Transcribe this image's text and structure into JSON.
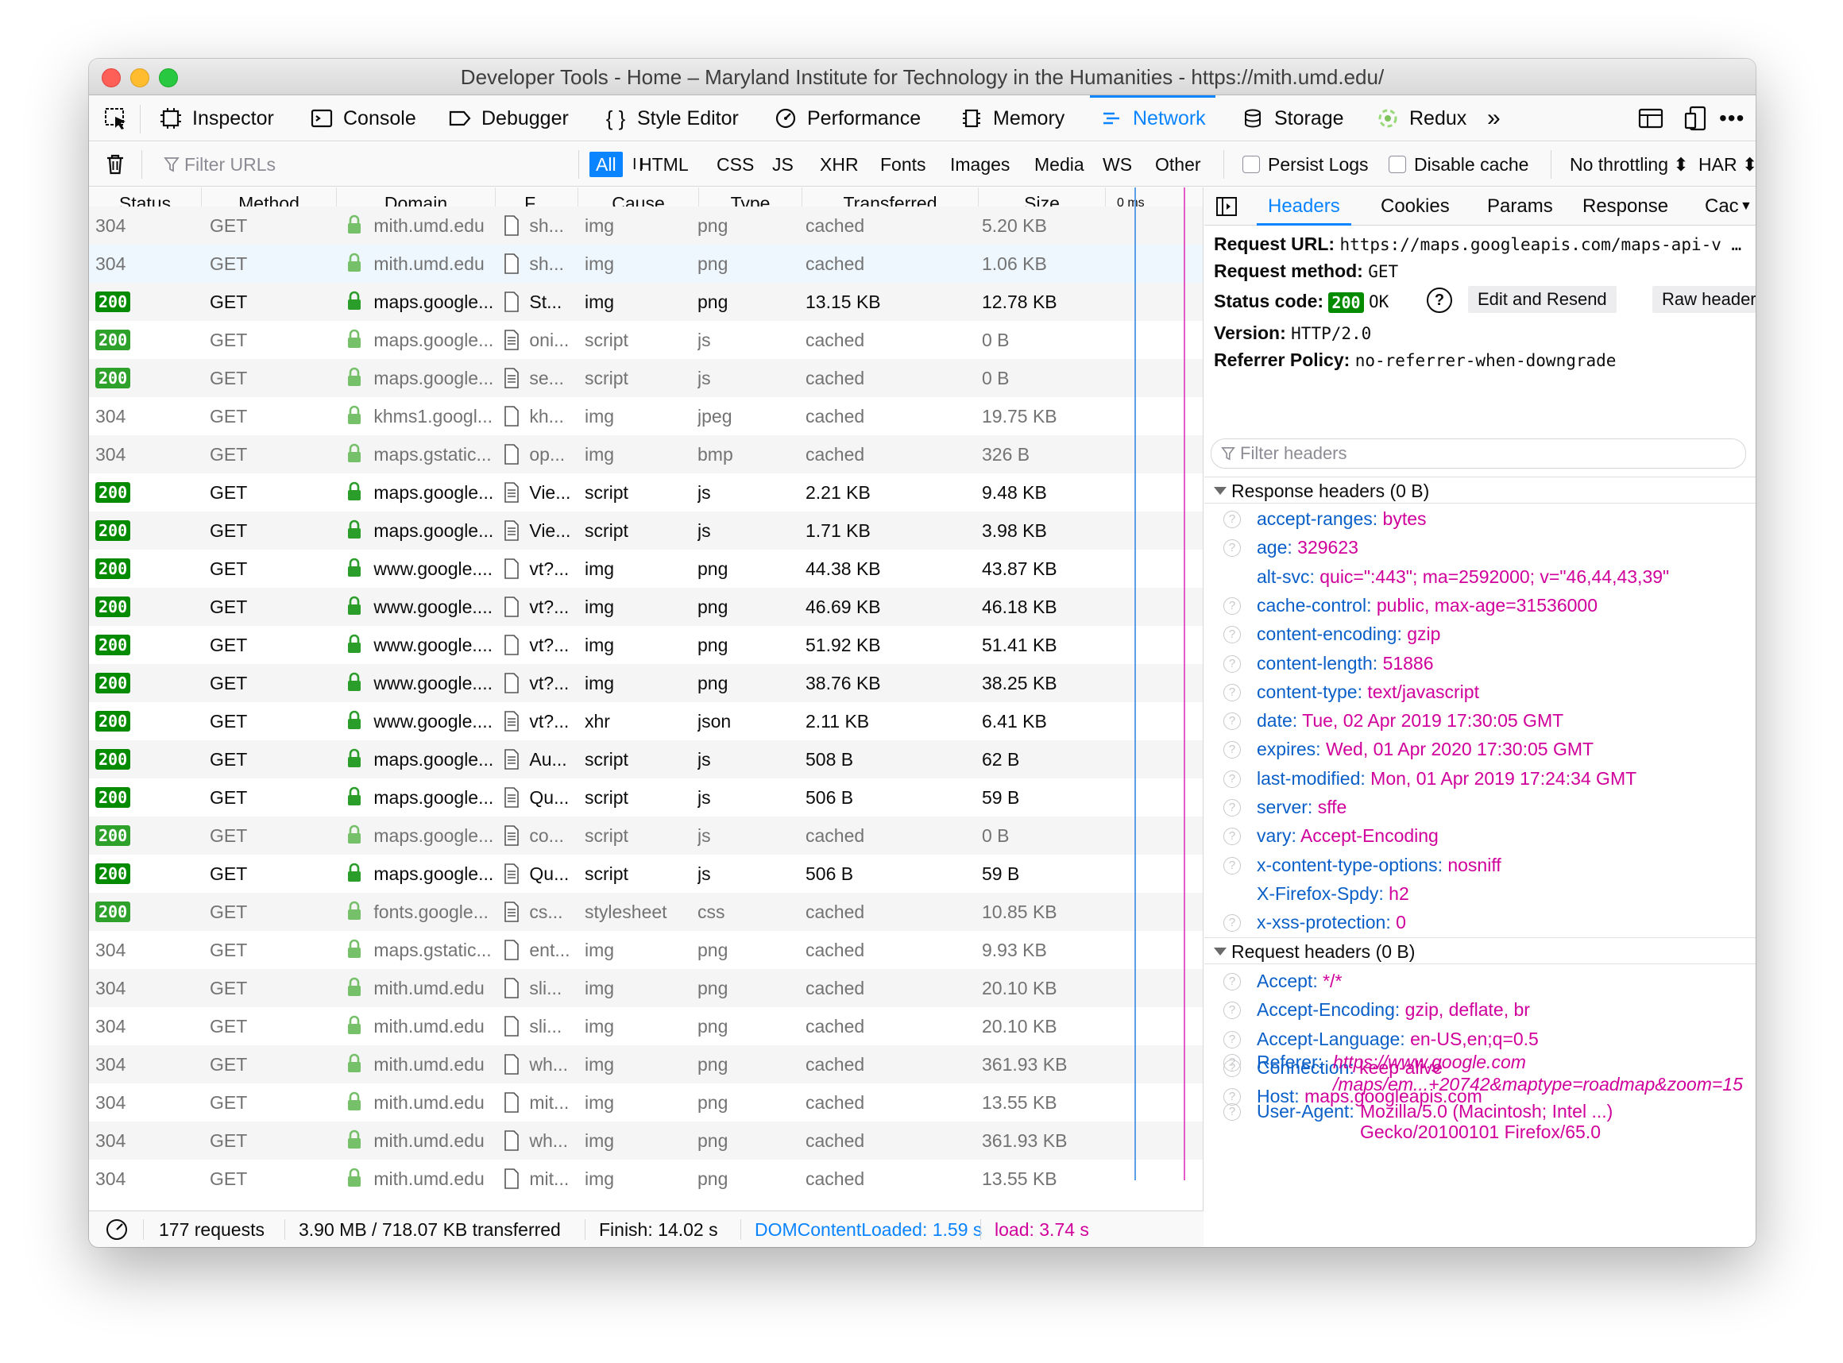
{
  "window": {
    "title": "Developer Tools - Home – Maryland Institute for Technology in the Humanities - https://mith.umd.edu/"
  },
  "toolbar": {
    "picker_icon": "element-picker-icon",
    "tools": [
      {
        "label": "Inspector",
        "icon": "inspector-icon"
      },
      {
        "label": "Console",
        "icon": "console-icon"
      },
      {
        "label": "Debugger",
        "icon": "debugger-icon"
      },
      {
        "label": "Style Editor",
        "icon": "braces-icon"
      },
      {
        "label": "Performance",
        "icon": "gauge-icon"
      },
      {
        "label": "Memory",
        "icon": "chip-icon"
      },
      {
        "label": "Network",
        "icon": "network-icon",
        "selected": true
      },
      {
        "label": "Storage",
        "icon": "database-icon"
      },
      {
        "label": "Redux",
        "icon": "redux-icon"
      }
    ],
    "overflow": "»",
    "accent": "#0a84ff"
  },
  "filterbar": {
    "placeholder": "Filter URLs",
    "pause": "I I",
    "types": [
      "All",
      "HTML",
      "CSS",
      "JS",
      "XHR",
      "Fonts",
      "Images",
      "Media",
      "WS",
      "Other"
    ],
    "active_type": "All",
    "persist_logs": "Persist Logs",
    "disable_cache": "Disable cache",
    "throttling": "No throttling ⬍",
    "har": "HAR ⬍"
  },
  "columns": [
    "Status",
    "Method",
    "Domain",
    "F...",
    "Cause",
    "Type",
    "Transferred",
    "Size"
  ],
  "waterfall_label": "0 ms",
  "requests": [
    {
      "status": "304",
      "method": "GET",
      "domain": "mith.umd.edu",
      "file": "sh...",
      "cause": "img",
      "type": "png",
      "transferred": "cached",
      "size": "5.20 KB",
      "cached": true
    },
    {
      "status": "304",
      "method": "GET",
      "domain": "mith.umd.edu",
      "file": "sh...",
      "cause": "img",
      "type": "png",
      "transferred": "cached",
      "size": "1.06 KB",
      "cached": true
    },
    {
      "status": "200",
      "method": "GET",
      "domain": "maps.google...",
      "file": "St...",
      "cause": "img",
      "type": "png",
      "transferred": "13.15 KB",
      "size": "12.78 KB",
      "cached": false
    },
    {
      "status": "200",
      "method": "GET",
      "domain": "maps.google...",
      "file": "oni...",
      "cause": "script",
      "type": "js",
      "transferred": "cached",
      "size": "0 B",
      "cached": true
    },
    {
      "status": "200",
      "method": "GET",
      "domain": "maps.google...",
      "file": "se...",
      "cause": "script",
      "type": "js",
      "transferred": "cached",
      "size": "0 B",
      "cached": true
    },
    {
      "status": "304",
      "method": "GET",
      "domain": "khms1.googl...",
      "file": "kh...",
      "cause": "img",
      "type": "jpeg",
      "transferred": "cached",
      "size": "19.75 KB",
      "cached": true
    },
    {
      "status": "304",
      "method": "GET",
      "domain": "maps.gstatic...",
      "file": "op...",
      "cause": "img",
      "type": "bmp",
      "transferred": "cached",
      "size": "326 B",
      "cached": true
    },
    {
      "status": "200",
      "method": "GET",
      "domain": "maps.google...",
      "file": "Vie...",
      "cause": "script",
      "type": "js",
      "transferred": "2.21 KB",
      "size": "9.48 KB",
      "cached": false
    },
    {
      "status": "200",
      "method": "GET",
      "domain": "maps.google...",
      "file": "Vie...",
      "cause": "script",
      "type": "js",
      "transferred": "1.71 KB",
      "size": "3.98 KB",
      "cached": false
    },
    {
      "status": "200",
      "method": "GET",
      "domain": "www.google....",
      "file": "vt?...",
      "cause": "img",
      "type": "png",
      "transferred": "44.38 KB",
      "size": "43.87 KB",
      "cached": false
    },
    {
      "status": "200",
      "method": "GET",
      "domain": "www.google....",
      "file": "vt?...",
      "cause": "img",
      "type": "png",
      "transferred": "46.69 KB",
      "size": "46.18 KB",
      "cached": false
    },
    {
      "status": "200",
      "method": "GET",
      "domain": "www.google....",
      "file": "vt?...",
      "cause": "img",
      "type": "png",
      "transferred": "51.92 KB",
      "size": "51.41 KB",
      "cached": false
    },
    {
      "status": "200",
      "method": "GET",
      "domain": "www.google....",
      "file": "vt?...",
      "cause": "img",
      "type": "png",
      "transferred": "38.76 KB",
      "size": "38.25 KB",
      "cached": false
    },
    {
      "status": "200",
      "method": "GET",
      "domain": "www.google....",
      "file": "vt?...",
      "cause": "xhr",
      "type": "json",
      "transferred": "2.11 KB",
      "size": "6.41 KB",
      "cached": false
    },
    {
      "status": "200",
      "method": "GET",
      "domain": "maps.google...",
      "file": "Au...",
      "cause": "script",
      "type": "js",
      "transferred": "508 B",
      "size": "62 B",
      "cached": false
    },
    {
      "status": "200",
      "method": "GET",
      "domain": "maps.google...",
      "file": "Qu...",
      "cause": "script",
      "type": "js",
      "transferred": "506 B",
      "size": "59 B",
      "cached": false
    },
    {
      "status": "200",
      "method": "GET",
      "domain": "maps.google...",
      "file": "co...",
      "cause": "script",
      "type": "js",
      "transferred": "cached",
      "size": "0 B",
      "cached": true
    },
    {
      "status": "200",
      "method": "GET",
      "domain": "maps.google...",
      "file": "Qu...",
      "cause": "script",
      "type": "js",
      "transferred": "506 B",
      "size": "59 B",
      "cached": false
    },
    {
      "status": "200",
      "method": "GET",
      "domain": "fonts.google...",
      "file": "cs...",
      "cause": "stylesheet",
      "type": "css",
      "transferred": "cached",
      "size": "10.85 KB",
      "cached": true
    },
    {
      "status": "304",
      "method": "GET",
      "domain": "maps.gstatic...",
      "file": "ent...",
      "cause": "img",
      "type": "png",
      "transferred": "cached",
      "size": "9.93 KB",
      "cached": true
    },
    {
      "status": "304",
      "method": "GET",
      "domain": "mith.umd.edu",
      "file": "sli...",
      "cause": "img",
      "type": "png",
      "transferred": "cached",
      "size": "20.10 KB",
      "cached": true
    },
    {
      "status": "304",
      "method": "GET",
      "domain": "mith.umd.edu",
      "file": "sli...",
      "cause": "img",
      "type": "png",
      "transferred": "cached",
      "size": "20.10 KB",
      "cached": true
    },
    {
      "status": "304",
      "method": "GET",
      "domain": "mith.umd.edu",
      "file": "wh...",
      "cause": "img",
      "type": "png",
      "transferred": "cached",
      "size": "361.93 KB",
      "cached": true
    },
    {
      "status": "304",
      "method": "GET",
      "domain": "mith.umd.edu",
      "file": "mit...",
      "cause": "img",
      "type": "png",
      "transferred": "cached",
      "size": "13.55 KB",
      "cached": true
    },
    {
      "status": "304",
      "method": "GET",
      "domain": "mith.umd.edu",
      "file": "wh...",
      "cause": "img",
      "type": "png",
      "transferred": "cached",
      "size": "361.93 KB",
      "cached": true
    },
    {
      "status": "304",
      "method": "GET",
      "domain": "mith.umd.edu",
      "file": "mit...",
      "cause": "img",
      "type": "png",
      "transferred": "cached",
      "size": "13.55 KB",
      "cached": true
    }
  ],
  "statusbar": {
    "requests": "177 requests",
    "transferred": "3.90 MB / 718.07 KB transferred",
    "finish": "Finish: 14.02 s",
    "dom": "DOMContentLoaded: 1.59 s",
    "load": "load: 3.74 s",
    "dom_color": "#0a84ff",
    "load_color": "#d0009b"
  },
  "side": {
    "tabs": [
      "Headers",
      "Cookies",
      "Params",
      "Response",
      "Cac"
    ],
    "selected_tab": "Headers",
    "summary": {
      "url_label": "Request URL:",
      "url": "https://maps.googleapis.com/maps-api-v …",
      "method_label": "Request method:",
      "method": "GET",
      "status_label": "Status code:",
      "status_code": "200",
      "status_text": "OK",
      "edit_resend": "Edit and Resend",
      "raw_headers": "Raw headers",
      "version_label": "Version:",
      "version": "HTTP/2.0",
      "referrer_label": "Referrer Policy:",
      "referrer": "no-referrer-when-downgrade"
    },
    "filter_placeholder": "Filter headers",
    "response_title": "Response headers (0 B)",
    "response_headers": [
      {
        "name": "accept-ranges:",
        "value": "bytes",
        "help": true
      },
      {
        "name": "age:",
        "value": "329623",
        "help": true
      },
      {
        "name": "alt-svc:",
        "value": "quic=\":443\"; ma=2592000; v=\"46,44,43,39\"",
        "help": false
      },
      {
        "name": "cache-control:",
        "value": "public, max-age=31536000",
        "help": true
      },
      {
        "name": "content-encoding:",
        "value": "gzip",
        "help": true
      },
      {
        "name": "content-length:",
        "value": "51886",
        "help": true
      },
      {
        "name": "content-type:",
        "value": "text/javascript",
        "help": true
      },
      {
        "name": "date:",
        "value": "Tue, 02 Apr 2019 17:30:05 GMT",
        "help": true
      },
      {
        "name": "expires:",
        "value": "Wed, 01 Apr 2020 17:30:05 GMT",
        "help": true
      },
      {
        "name": "last-modified:",
        "value": "Mon, 01 Apr 2019 17:24:34 GMT",
        "help": true
      },
      {
        "name": "server:",
        "value": "sffe",
        "help": true
      },
      {
        "name": "vary:",
        "value": "Accept-Encoding",
        "help": true
      },
      {
        "name": "x-content-type-options:",
        "value": "nosniff",
        "help": true
      },
      {
        "name": "X-Firefox-Spdy:",
        "value": "h2",
        "help": false
      },
      {
        "name": "x-xss-protection:",
        "value": "0",
        "help": true
      }
    ],
    "request_title": "Request headers (0 B)",
    "request_headers": [
      {
        "name": "Accept:",
        "value": "*/*"
      },
      {
        "name": "Accept-Encoding:",
        "value": "gzip, deflate, br"
      },
      {
        "name": "Accept-Language:",
        "value": "en-US,en;q=0.5"
      },
      {
        "name": "Connection:",
        "value": "keep-alive"
      },
      {
        "name": "Host:",
        "value": "maps.googleapis.com"
      }
    ],
    "referer": {
      "name": "Referer:",
      "line1": "https://www.google.com",
      "line2": "/maps/em...+20742&maptype=roadmap&zoom=15"
    },
    "user_agent": {
      "name": "User-Agent:",
      "line1": "Mozilla/5.0 (Macintosh; Intel ...)",
      "line2": "Gecko/20100101 Firefox/65.0"
    }
  }
}
